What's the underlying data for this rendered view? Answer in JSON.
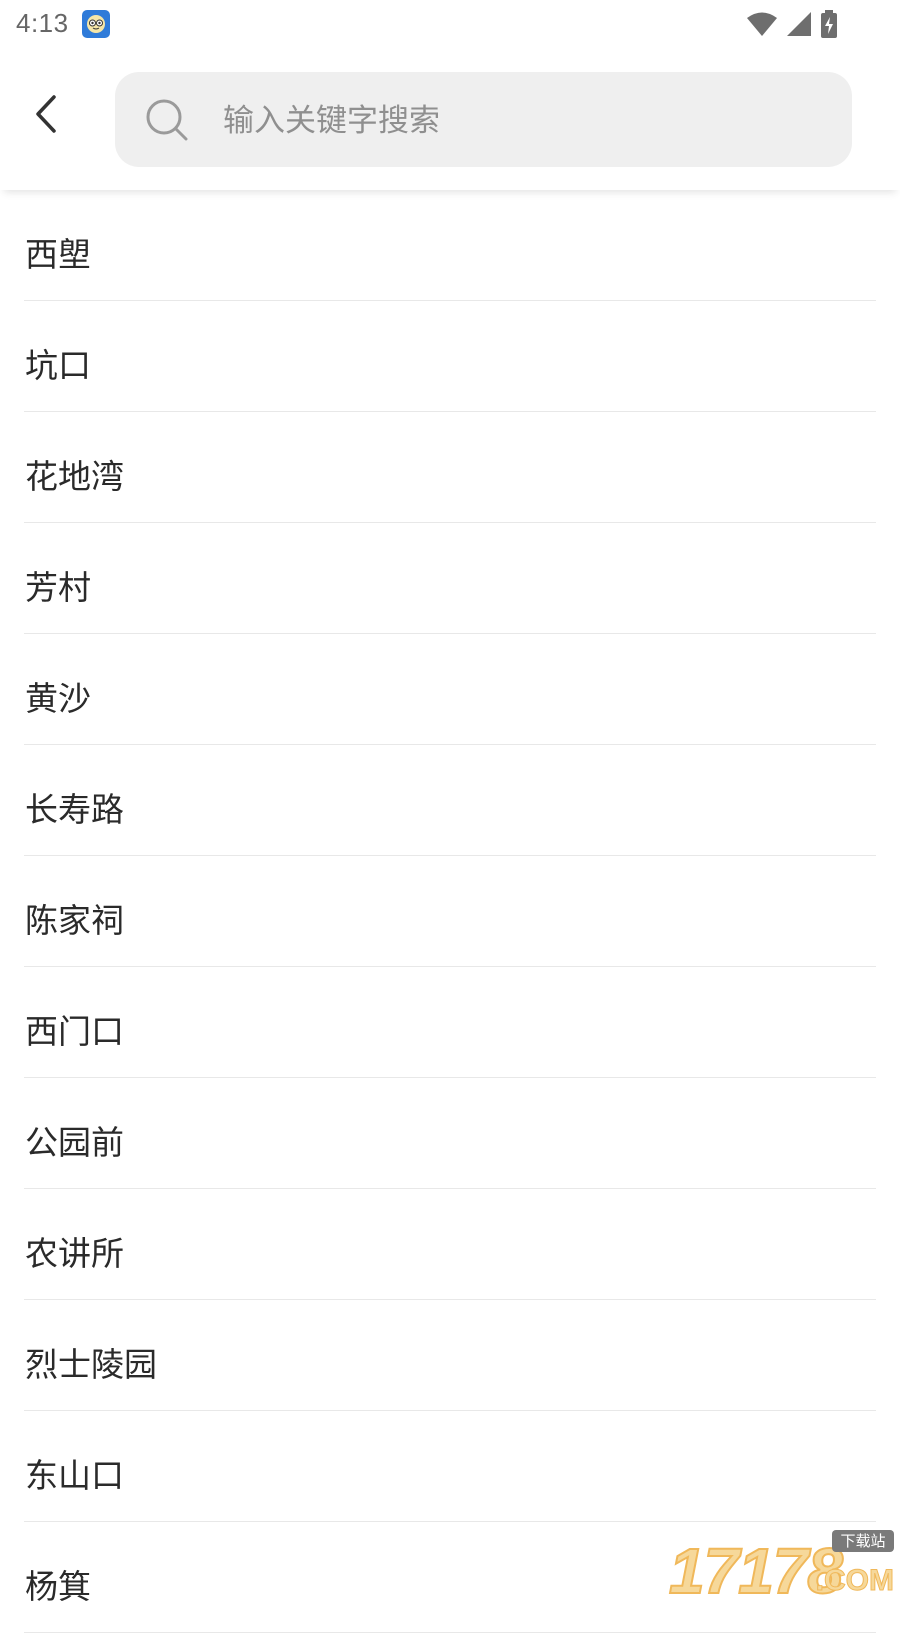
{
  "status_bar": {
    "time": "4:13",
    "app_icon": "assistant-face-icon",
    "icons": [
      "wifi-icon",
      "cellular-signal-icon",
      "battery-charging-icon"
    ]
  },
  "header": {
    "back_icon": "chevron-left-icon",
    "search": {
      "icon": "search-icon",
      "placeholder": "输入关键字搜索",
      "value": ""
    }
  },
  "stations": [
    {
      "label": "西塱"
    },
    {
      "label": "坑口"
    },
    {
      "label": "花地湾"
    },
    {
      "label": "芳村"
    },
    {
      "label": "黄沙"
    },
    {
      "label": "长寿路"
    },
    {
      "label": "陈家祠"
    },
    {
      "label": "西门口"
    },
    {
      "label": "公园前"
    },
    {
      "label": "农讲所"
    },
    {
      "label": "烈士陵园"
    },
    {
      "label": "东山口"
    },
    {
      "label": "杨箕"
    }
  ],
  "watermark": {
    "number": "17178",
    "tag": "下载站",
    "suffix": ".COM"
  },
  "colors": {
    "background": "#ffffff",
    "search_bg": "#efefef",
    "divider": "#e8e8e8",
    "text": "#2a2a2a",
    "placeholder": "#8f8f8f"
  }
}
